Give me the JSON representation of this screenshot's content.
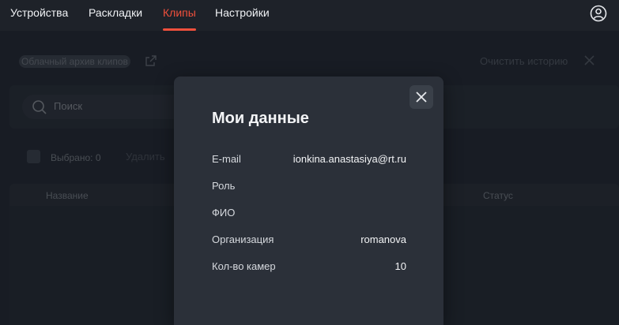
{
  "nav": {
    "items": [
      {
        "label": "Устройства",
        "active": false
      },
      {
        "label": "Раскладки",
        "active": false
      },
      {
        "label": "Клипы",
        "active": true
      },
      {
        "label": "Настройки",
        "active": false
      }
    ],
    "accent_color": "#f0503c",
    "user_icon": "user-circle-icon"
  },
  "page": {
    "archive_label": "Облачный архив клипов",
    "clear_history_label": "Очистить историю",
    "search": {
      "placeholder": "Поиск"
    },
    "selected_label": "Выбрано: 0",
    "delete_label": "Удалить",
    "table": {
      "headers": {
        "name": "Название",
        "status": "Статус"
      }
    }
  },
  "modal": {
    "title": "Мои данные",
    "rows": [
      {
        "label": "E-mail",
        "value": "ionkina.anastasiya@rt.ru"
      },
      {
        "label": "Роль",
        "value": ""
      },
      {
        "label": "ФИО",
        "value": ""
      },
      {
        "label": "Организация",
        "value": "romanova"
      },
      {
        "label": "Кол-во камер",
        "value": "10"
      }
    ],
    "close_icon": "close-icon"
  }
}
